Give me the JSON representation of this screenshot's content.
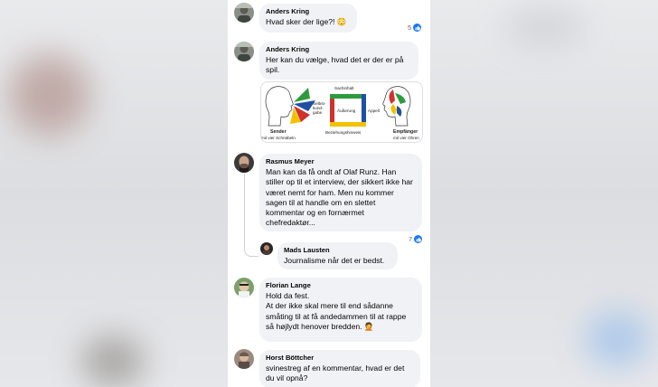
{
  "comments": [
    {
      "author": "Anders Kring",
      "text": "Hvad sker der lige?! 😳",
      "likes": "5"
    },
    {
      "author": "Anders Kring",
      "text": "Her kan du vælge, hvad det er der er på spil."
    },
    {
      "author": "Rasmus Meyer",
      "text": "Man kan da få ondt af Olaf Runz. Han stiller op til et interview, der sikkert ikke har været nemt for ham. Men nu kommer sagen til at handle om en slettet kommentar og en fornærmet chefredaktør...",
      "likes": "7"
    },
    {
      "author": "Mads Lausten",
      "text": "Journalisme når det er bedst."
    },
    {
      "author": "Florian Lange",
      "text_lines": [
        "Hold da fest.",
        "At der ikke skal mere til end sådanne småting til at få andedammen til at rappe så højlydt henover bredden. 🤦"
      ]
    },
    {
      "author": "Horst Böttcher",
      "text": "svinestreg af en kommentar, hvad er det du vil opnå?"
    }
  ],
  "diagram": {
    "top": "Sachinhalt",
    "bottom": "Beziehungshinweis",
    "center": "Äußerung",
    "right": "Appell",
    "left_lines": [
      "Selbst-",
      "kund-",
      "gabe"
    ],
    "sender": "Sender",
    "sender_sub": "mit vier Schnäbeln",
    "receiver": "Empfänger",
    "receiver_sub": "mit vier Ohren"
  },
  "colors": {
    "like_blue": "#1877f2",
    "bubble": "#f0f2f5",
    "red": "#d0312d",
    "green": "#2e9a3e",
    "yellow": "#f2c200",
    "blue": "#1f4fa3"
  }
}
